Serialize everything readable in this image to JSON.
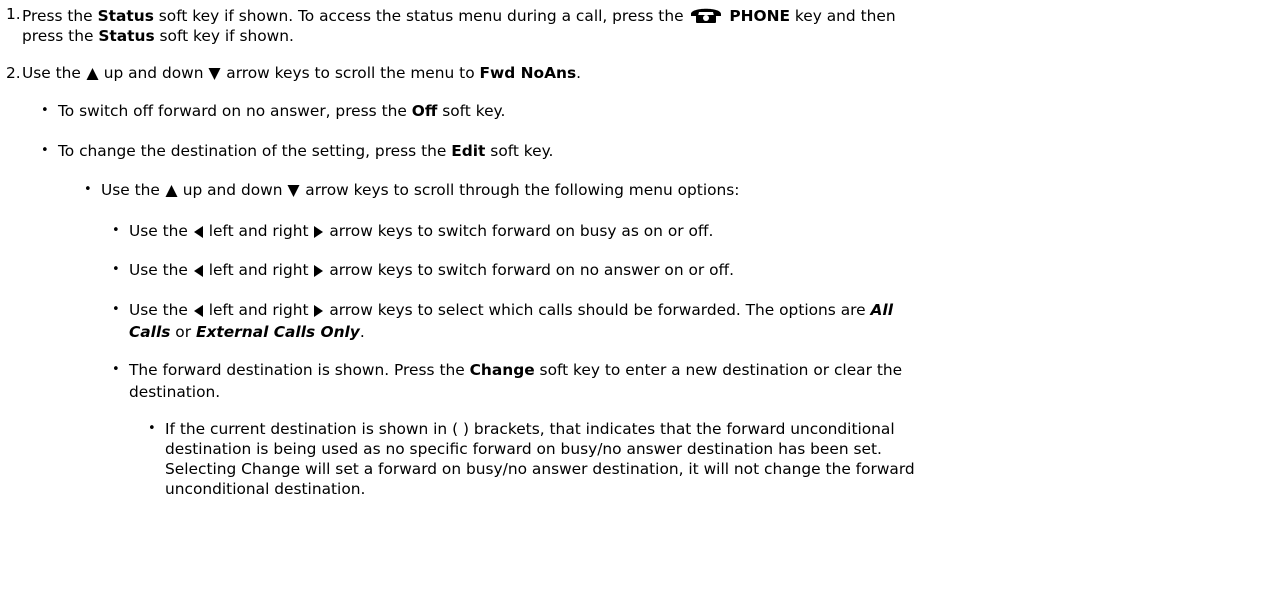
{
  "steps": [
    {
      "num": "1.",
      "line1_a": "Press the ",
      "status_kw": "Status",
      "line1_b": " soft key if shown. To access the status menu during a call, press the ",
      "phone_kw": "PHONE",
      "line1_c": " key and then",
      "line2_a": "press the ",
      "line2_kw": "Status",
      "line2_b": " soft key if shown.",
      "phone_icon": "phone-key-icon"
    },
    {
      "num": "2.",
      "a": "Use the ",
      "b": " up and down ",
      "c": " arrow keys to scroll the menu to ",
      "kw": "Fwd NoAns",
      "d": "."
    }
  ],
  "bullets_l1": [
    {
      "a": "To switch off forward on no answer, press the ",
      "kw": "Off",
      "b": " soft key."
    },
    {
      "a": "To change the destination of the setting, press the ",
      "kw": "Edit",
      "b": " soft key."
    }
  ],
  "bullet_l2": {
    "a": "Use the ",
    "b": " up and down ",
    "c": " arrow keys to scroll through the following menu options:"
  },
  "bullets_l3": [
    {
      "a": "Use the ",
      "b": " left and right ",
      "c": " arrow keys to switch forward on busy as on or off."
    },
    {
      "a": "Use the ",
      "b": " left and right ",
      "c": " arrow keys to switch forward on no answer on or off."
    },
    {
      "a": "Use the ",
      "b": " left and right ",
      "c": " arrow keys to select which calls should be forwarded. The options are ",
      "opt1a": "All",
      "opt1b": "Calls",
      "or": " or ",
      "opt2": "External Calls Only",
      "end": "."
    },
    {
      "a": "The forward destination is shown. Press the ",
      "kw": "Change",
      "b": " soft key to enter a new destination or clear the",
      "line2": "destination."
    }
  ],
  "bullet_l4": {
    "line1": "If the current destination is shown in ( ) brackets, that indicates that the forward unconditional",
    "line2": "destination is being used as no specific forward on busy/no answer destination has been set.",
    "line3": "Selecting Change will set a forward on busy/no answer destination, it will not change the forward",
    "line4": "unconditional destination."
  },
  "glyphs": {
    "bullet": "•"
  },
  "icons": {
    "up": "arrow-up-icon",
    "down": "arrow-down-icon",
    "left": "arrow-left-icon",
    "right": "arrow-right-icon"
  }
}
